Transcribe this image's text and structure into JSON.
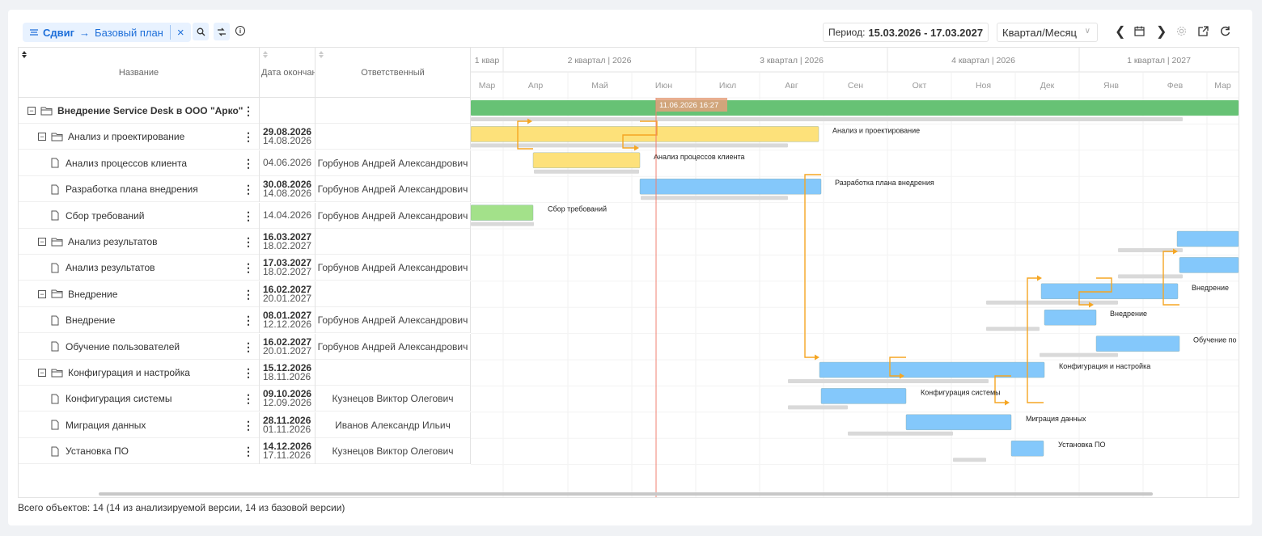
{
  "toolbar": {
    "chip_mode": "Сдвиг",
    "chip_arrow": "→",
    "chip_version": "Базовый план",
    "chip_close": "×",
    "period_label": "Период:",
    "period_value": "15.03.2026 - 17.03.2027",
    "scale_value": "Квартал/Месяц",
    "prev_icon": "chevron-left-icon",
    "calendar_icon": "calendar-icon",
    "next_icon": "chevron-right-icon",
    "settings_icon": "gear-icon",
    "export_icon": "export-icon",
    "refresh_icon": "refresh-icon"
  },
  "columns": {
    "name": "Название",
    "date": "Дата окончан",
    "responsible": "Ответственный"
  },
  "timeline": {
    "quarters": [
      "1 квар",
      "2 квартал | 2026",
      "3 квартал | 2026",
      "4 квартал | 2026",
      "1 квартал | 2027"
    ],
    "months": [
      "Мар",
      "Апр",
      "Май",
      "Июн",
      "Июл",
      "Авг",
      "Сен",
      "Окт",
      "Ноя",
      "Дек",
      "Янв",
      "Фев",
      "Мар"
    ],
    "today_label": "11.06.2026 16:27"
  },
  "rows": [
    {
      "name": "Внедрение Service Desk в ООО \"Арко\"",
      "date1": "",
      "date2": "",
      "resp": "",
      "level": 0,
      "bar_label": ""
    },
    {
      "name": "Анализ и проектирование",
      "date1": "29.08.2026",
      "date2": "14.08.2026",
      "resp": "",
      "level": 1,
      "bar_label": "Анализ и проектирование"
    },
    {
      "name": "Анализ процессов клиента",
      "date1": "",
      "date2": "04.06.2026",
      "resp": "Горбунов Андрей Александрович",
      "level": 2,
      "bar_label": "Анализ процессов клиента"
    },
    {
      "name": "Разработка плана внедрения",
      "date1": "30.08.2026",
      "date2": "14.08.2026",
      "resp": "Горбунов Андрей Александрович",
      "level": 2,
      "bar_label": "Разработка плана внедрения"
    },
    {
      "name": "Сбор требований",
      "date1": "",
      "date2": "14.04.2026",
      "resp": "Горбунов Андрей Александрович",
      "level": 2,
      "bar_label": "Сбор требований"
    },
    {
      "name": "Анализ результатов",
      "date1": "16.03.2027",
      "date2": "18.02.2027",
      "resp": "",
      "level": 1,
      "bar_label": ""
    },
    {
      "name": "Анализ результатов",
      "date1": "17.03.2027",
      "date2": "18.02.2027",
      "resp": "Горбунов Андрей Александрович",
      "level": 2,
      "bar_label": ""
    },
    {
      "name": "Внедрение",
      "date1": "16.02.2027",
      "date2": "20.01.2027",
      "resp": "",
      "level": 1,
      "bar_label": "Внедрение"
    },
    {
      "name": "Внедрение",
      "date1": "08.01.2027",
      "date2": "12.12.2026",
      "resp": "Горбунов Андрей Александрович",
      "level": 2,
      "bar_label": "Внедрение"
    },
    {
      "name": "Обучение пользователей",
      "date1": "16.02.2027",
      "date2": "20.01.2027",
      "resp": "Горбунов Андрей Александрович",
      "level": 2,
      "bar_label": "Обучение по"
    },
    {
      "name": "Конфигурация и настройка",
      "date1": "15.12.2026",
      "date2": "18.11.2026",
      "resp": "",
      "level": 1,
      "bar_label": "Конфигурация и настройка"
    },
    {
      "name": "Конфигурация системы",
      "date1": "09.10.2026",
      "date2": "12.09.2026",
      "resp": "Кузнецов Виктор Олегович",
      "level": 2,
      "bar_label": "Конфигурация системы"
    },
    {
      "name": "Миграция данных",
      "date1": "28.11.2026",
      "date2": "01.11.2026",
      "resp": "Иванов Александр Ильич",
      "level": 2,
      "bar_label": "Миграция данных"
    },
    {
      "name": "Установка ПО",
      "date1": "14.12.2026",
      "date2": "17.11.2026",
      "resp": "Кузнецов Виктор Олегович",
      "level": 2,
      "bar_label": "Установка ПО"
    }
  ],
  "footer": "Всего объектов: 14 (14 из анализируемой версии, 14 из базовой версии)",
  "colors": {
    "accent": "#1e6fd9",
    "bar_summary": "#67c275",
    "bar_yellow": "#fde17a",
    "bar_blue": "#84c8fb",
    "bar_green": "#a3e18a",
    "baseline": "#d9d9d9",
    "link": "#f5a623",
    "today": "#f08070"
  }
}
